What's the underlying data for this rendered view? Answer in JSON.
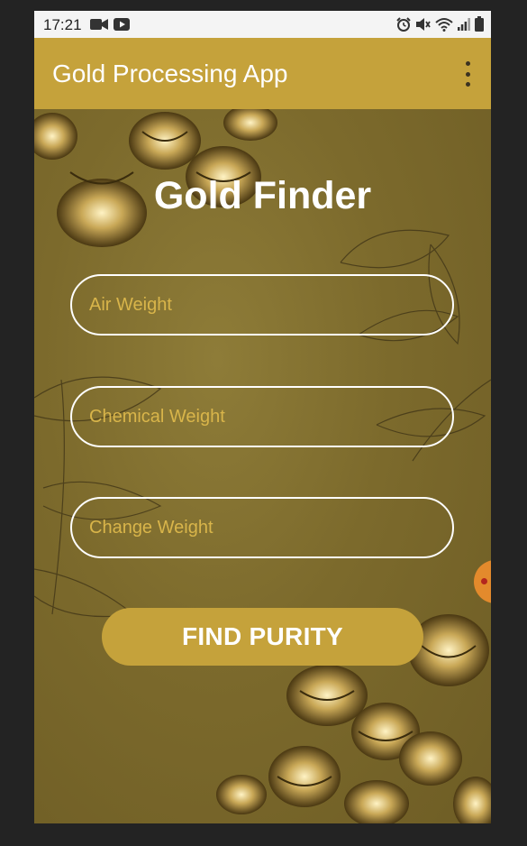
{
  "status_bar": {
    "time": "17:21",
    "left_icons": [
      "video-camera-icon",
      "youtube-icon"
    ],
    "right_icons": [
      "alarm-icon",
      "mute-icon",
      "wifi-icon",
      "signal-icon",
      "battery-icon"
    ]
  },
  "app_bar": {
    "title": "Gold Processing App",
    "menu_icon": "more-vert-icon"
  },
  "main": {
    "title": "Gold Finder",
    "fields": {
      "air_weight": {
        "placeholder": "Air Weight",
        "value": ""
      },
      "chemical_weight": {
        "placeholder": "Chemical Weight",
        "value": ""
      },
      "change_weight": {
        "placeholder": "Change Weight",
        "value": ""
      }
    },
    "button_label": "FIND PURITY"
  },
  "colors": {
    "accent": "#c5a23b",
    "background": "#7d6a2a",
    "placeholder": "#d9b54a",
    "text_on_accent": "#ffffff"
  }
}
